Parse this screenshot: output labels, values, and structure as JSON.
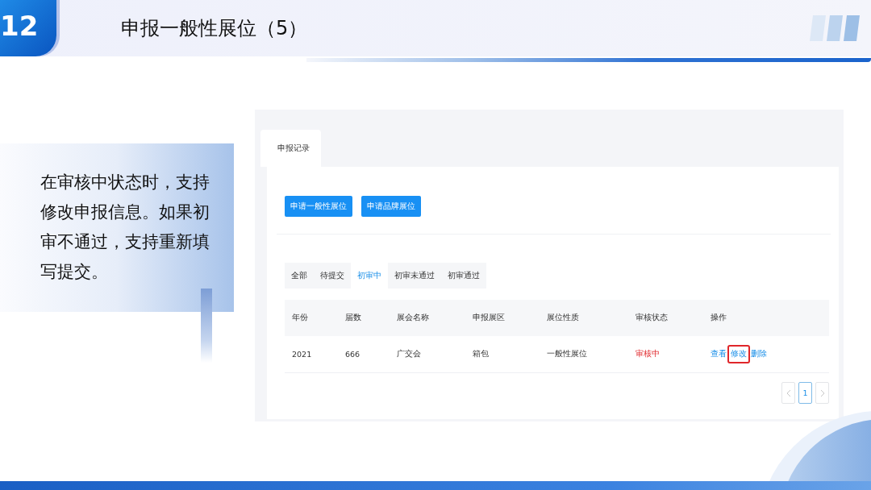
{
  "slide": {
    "number": "12",
    "title": "申报一般性展位（5）"
  },
  "callout": {
    "text": "在审核中状态时，支持修改申报信息。如果初审不通过，支持重新填写提交。"
  },
  "screen": {
    "tabs": [
      {
        "label": "申报记录",
        "selected": true
      }
    ],
    "buttons": [
      "申请一般性展位",
      "申请品牌展位"
    ],
    "filters": [
      {
        "label": "全部",
        "selected": false
      },
      {
        "label": "待提交",
        "selected": false
      },
      {
        "label": "初审中",
        "selected": true
      },
      {
        "label": "初审未通过",
        "selected": false
      },
      {
        "label": "初审通过",
        "selected": false
      }
    ],
    "table": {
      "columns": [
        "年份",
        "届数",
        "展会名称",
        "申报展区",
        "展位性质",
        "审核状态",
        "操作"
      ],
      "rows": [
        {
          "cells": [
            "2021",
            "666",
            "广交会",
            "箱包",
            "一般性展位"
          ],
          "status": {
            "label": "审核中",
            "kind": "pending"
          },
          "actions": [
            {
              "label": "查看",
              "highlighted": false
            },
            {
              "label": "修改",
              "highlighted": true
            },
            {
              "label": "删除",
              "highlighted": false
            }
          ]
        }
      ]
    },
    "pagination": {
      "pages": [
        {
          "label": "1",
          "selected": true
        }
      ]
    }
  }
}
